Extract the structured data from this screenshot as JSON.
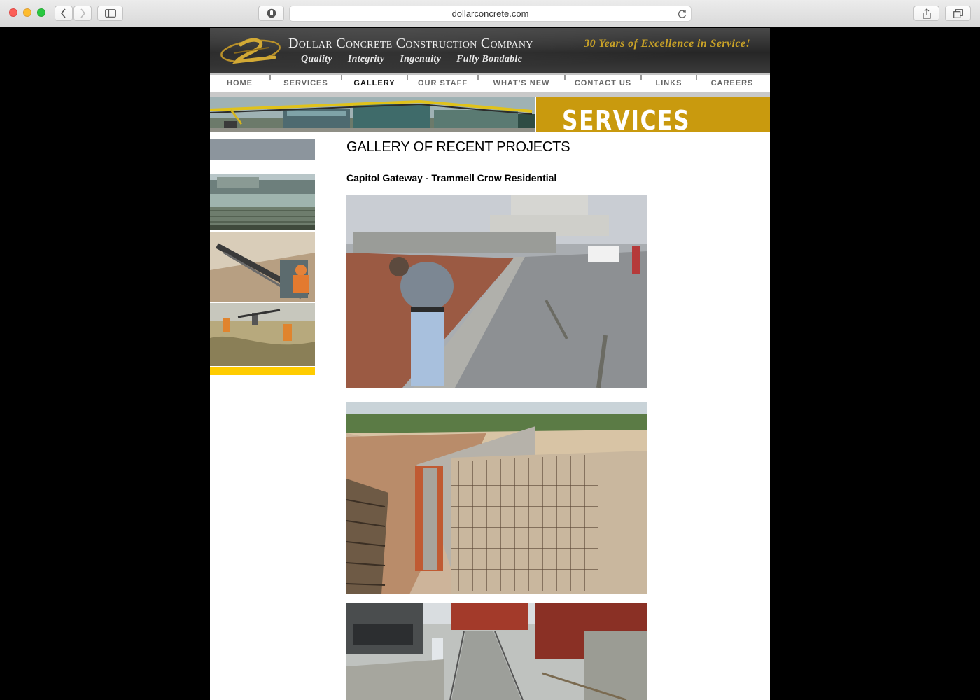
{
  "browser": {
    "url": "dollarconcrete.com"
  },
  "header": {
    "company": "Dollar Concrete Construction Company",
    "values": [
      "Quality",
      "Integrity",
      "Ingenuity",
      "Fully Bondable"
    ],
    "tagline": "30 Years of Excellence in Service!"
  },
  "nav": {
    "items": [
      "HOME",
      "SERVICES",
      "GALLERY",
      "OUR STAFF",
      "WHAT'S NEW",
      "CONTACT US",
      "LINKS",
      "CAREERS"
    ],
    "active": "GALLERY"
  },
  "banner": {
    "title": "SERVICES"
  },
  "content": {
    "heading": "GALLERY OF RECENT PROJECTS",
    "project": "Capitol Gateway - Trammell Crow Residential"
  },
  "colors": {
    "gold": "#c99a0e",
    "tagline_gold": "#c9a227",
    "sidebar_grey": "#8c959d",
    "sidebar_yellow": "#ffcc00"
  }
}
